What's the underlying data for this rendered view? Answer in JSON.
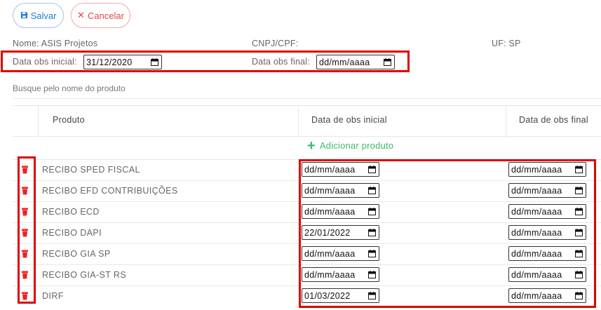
{
  "toolbar": {
    "save_label": "Salvar",
    "cancel_label": "Cancelar",
    "cancel_symbol": "✕"
  },
  "info": {
    "nome": "Nome: ASIS Projetos",
    "cnpj": "CNPJ/CPF:",
    "uf": "UF: SP"
  },
  "filters": {
    "inicial_label": "Data obs inicial:",
    "inicial_value": "31/12/2020",
    "final_label": "Data obs final:",
    "final_value": "dd/mm/aaaa"
  },
  "search_hint": "Busque pelo nome do produto",
  "table": {
    "headers": [
      "Produto",
      "Data de obs inicial",
      "Data de obs final"
    ],
    "add_label": "Adicionar produto",
    "rows": [
      {
        "produto": "RECIBO SPED FISCAL",
        "inicial": "dd/mm/aaaa",
        "final": "dd/mm/aaaa"
      },
      {
        "produto": "RECIBO EFD CONTRIBUIÇÕES",
        "inicial": "dd/mm/aaaa",
        "final": "dd/mm/aaaa"
      },
      {
        "produto": "RECIBO ECD",
        "inicial": "dd/mm/aaaa",
        "final": "dd/mm/aaaa"
      },
      {
        "produto": "RECIBO DAPI",
        "inicial": "22/01/2022",
        "final": "dd/mm/aaaa"
      },
      {
        "produto": "RECIBO GIA SP",
        "inicial": "dd/mm/aaaa",
        "final": "dd/mm/aaaa"
      },
      {
        "produto": "RECIBO GIA-ST RS",
        "inicial": "dd/mm/aaaa",
        "final": "dd/mm/aaaa"
      },
      {
        "produto": "DIRF",
        "inicial": "01/03/2022",
        "final": "dd/mm/aaaa"
      }
    ]
  },
  "colors": {
    "primary": "#1f7ad4",
    "danger": "#e84545",
    "success": "#3db86e",
    "highlight": "#e00000"
  },
  "icons": {
    "save": "floppy-disk-icon",
    "cancel": "close-icon",
    "add": "plus-icon",
    "delete": "trash-icon",
    "date": "calendar-icon"
  }
}
